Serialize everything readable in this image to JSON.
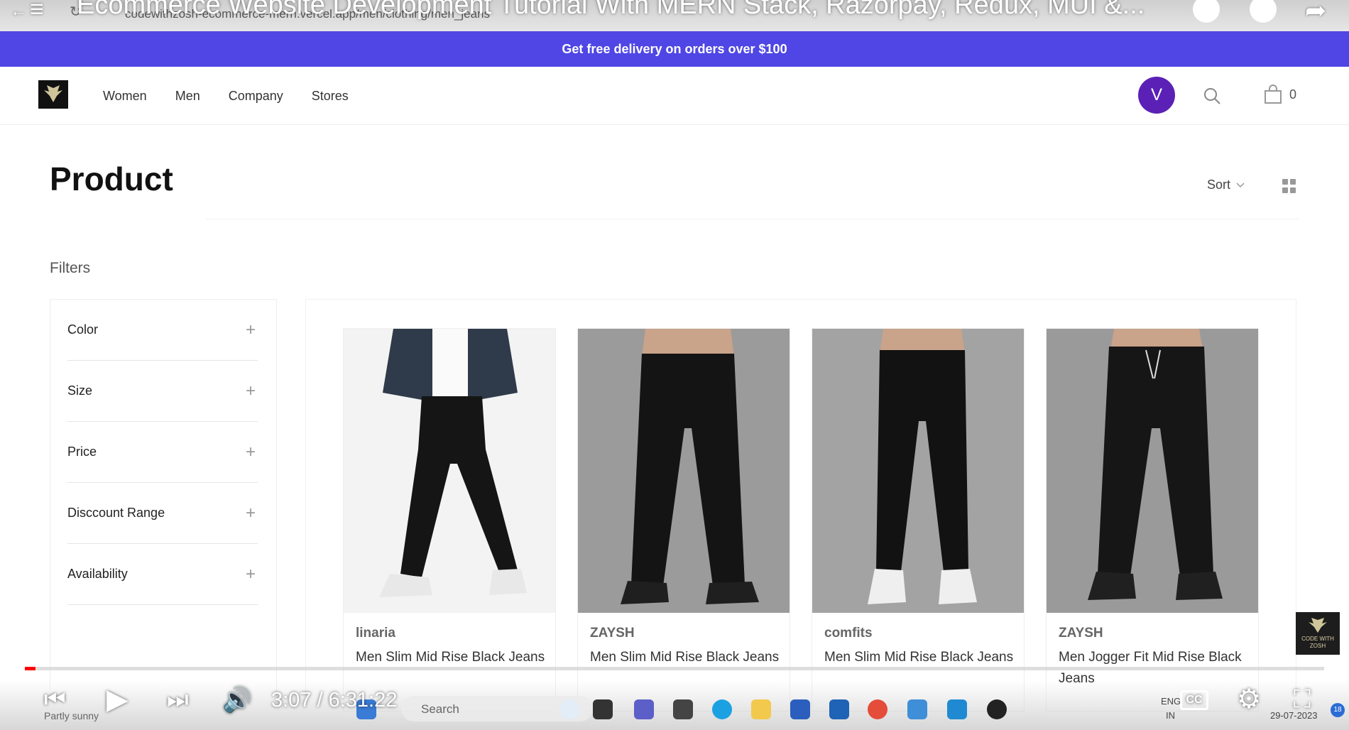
{
  "video": {
    "title": "Ecommerce Website Development Tutorial With MERN Stack, Razorpay, Redux, MUI &...",
    "time": "3:07 / 6:31:22",
    "progress_percent": 0.8
  },
  "browser": {
    "url": "codewithzosh-ecommerce-mern.vercel.app/men/clothing/men_jeans"
  },
  "announcement": "Get free delivery on orders over $100",
  "header": {
    "nav": [
      "Women",
      "Men",
      "Company",
      "Stores"
    ],
    "avatar_letter": "V",
    "cart_count": "0"
  },
  "page": {
    "title": "Product",
    "sort_label": "Sort"
  },
  "filters": {
    "heading": "Filters",
    "sections": [
      "Color",
      "Size",
      "Price",
      "Disccount Range",
      "Availability"
    ]
  },
  "products": [
    {
      "brand": "linaria",
      "title": "Men Slim Mid Rise Black Jeans"
    },
    {
      "brand": "ZAYSH",
      "title": "Men Slim Mid Rise Black Jeans"
    },
    {
      "brand": "comfits",
      "title": "Men Slim Mid Rise Black Jeans"
    },
    {
      "brand": "ZAYSH",
      "title": "Men Jogger Fit Mid Rise Black Jeans"
    }
  ],
  "corner_logo_text": "CODE WITH ZOSH",
  "taskbar": {
    "search_placeholder": "Search",
    "weather": "Partly sunny",
    "lang": "ENG",
    "region": "IN",
    "date": "29-07-2023",
    "notif_count": "18"
  },
  "colors": {
    "announcement_bg": "#4f46e5",
    "avatar_bg": "#5b21b6",
    "progress": "#ff0000"
  }
}
